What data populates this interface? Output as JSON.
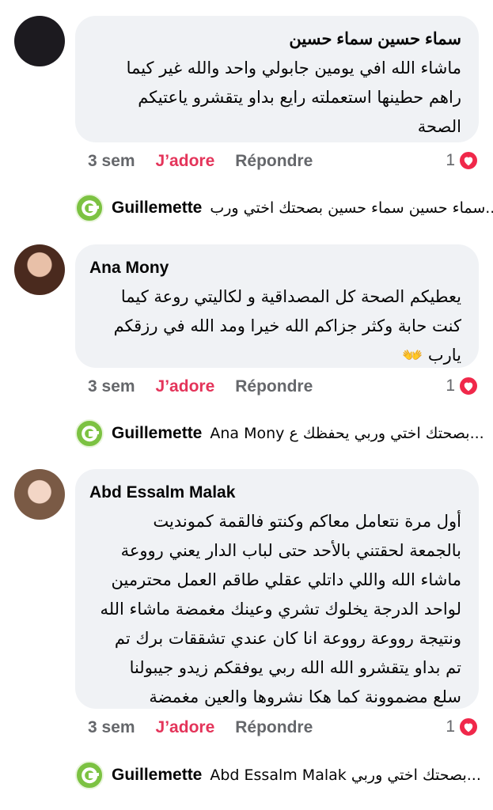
{
  "comments": [
    {
      "author": "سماء حسين سماء حسين",
      "lines": [
        "ماشاء الله افي يومين جابولي واحد والله غير كيما",
        "راهم حطينها استعملته رايع بداو يتقشرو ياعتيكم",
        "الصحة"
      ],
      "time": "3 sem",
      "love_label": "J’adore",
      "reply_label": "Répondre",
      "reaction_count": "1",
      "reply": {
        "author": "Guillemette",
        "snippet": "سماء حسين سماء حسين بصحتك اختي ورب..."
      }
    },
    {
      "author": "Ana Mony",
      "lines": [
        "يعطيكم الصحة كل المصداقية و لكاليتي روعة كيما",
        "كنت حابة وكثر جزاكم الله خيرا ومد الله في رزقكم",
        "يارب 👐"
      ],
      "time": "3 sem",
      "love_label": "J’adore",
      "reply_label": "Répondre",
      "reaction_count": "1",
      "reply": {
        "author": "Guillemette",
        "snippet": "Ana Mony بصحتك اختي وربي يحفظك ع..."
      }
    },
    {
      "author": "Abd Essalm Malak",
      "lines": [
        "أول مرة نتعامل معاكم وكنتو فالقمة كمونديت",
        "بالجمعة لحقتني بالأحد حتى لباب الدار يعني رووعة",
        "ماشاء الله واللي داتلي عقلي طاقم العمل محترمين",
        "لواحد الدرجة يخلوك تشري وعينك مغمضة ماشاء الله",
        "ونتيجة رووعة رووعة انا كان عندي تشققات برك تم",
        "تم بداو يتقشرو الله الله ربي يوفقكم زيدو جيبولنا",
        "سلع مضموونة كما هكا نشروها والعين مغمضة"
      ],
      "time": "3 sem",
      "love_label": "J’adore",
      "reply_label": "Répondre",
      "reaction_count": "1",
      "reply": {
        "author": "Guillemette",
        "snippet": "Abd Essalm Malak بصحتك اختي وربي..."
      }
    }
  ],
  "colors": {
    "love": "#e4345a",
    "bubble": "#f0f2f5",
    "muted": "#65676b",
    "brand_green": "#7cc242"
  },
  "icons": {
    "reaction": "heart-icon",
    "reply_avatar": "guillemette-logo-icon"
  }
}
